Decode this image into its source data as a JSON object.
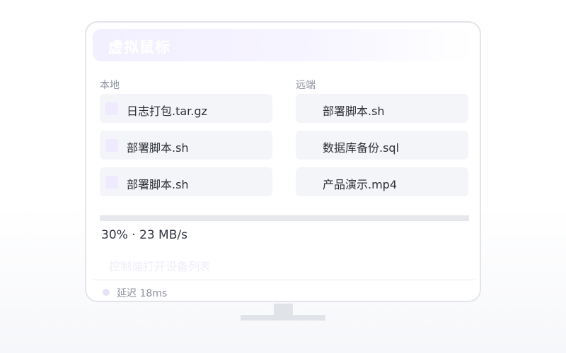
{
  "window": {
    "title": "虚拟鼠标"
  },
  "panels": {
    "local": {
      "header": "本地",
      "files": [
        {
          "name": "日志打包.tar.gz",
          "icon": "file-square-icon"
        },
        {
          "name": "部署脚本.sh",
          "icon": "file-square-icon"
        },
        {
          "name": "部署脚本.sh",
          "icon": "file-square-icon"
        }
      ]
    },
    "remote": {
      "header": "远端",
      "files": [
        {
          "name": "部署脚本.sh"
        },
        {
          "name": "数据库备份.sql"
        },
        {
          "name": "产品演示.mp4"
        }
      ]
    }
  },
  "transfer": {
    "progress": 0.3,
    "status": "30% · 23 MB/s"
  },
  "actions": {
    "open_device_list": "控制端打开设备列表"
  },
  "footer": {
    "latency": "延迟 18ms"
  },
  "colors": {
    "accent_tint": "#efeaff",
    "tile_background": "#f4f5f8",
    "progress_track": "#e6e8ed"
  }
}
